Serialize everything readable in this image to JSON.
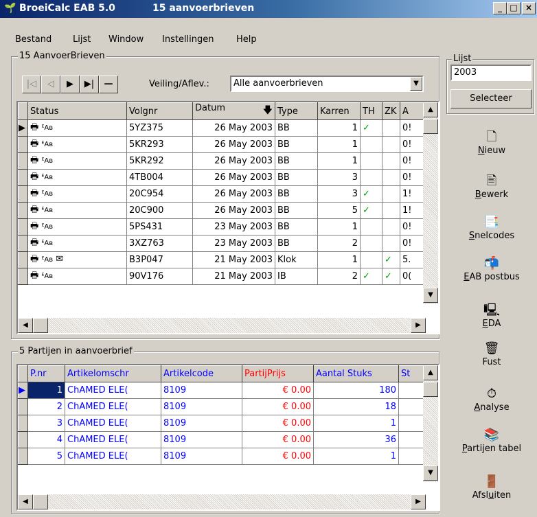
{
  "window": {
    "app": "BroeiCalc EAB 5.0",
    "doc": "15 aanvoerbrieven",
    "min": "_",
    "max": "□",
    "close": "×"
  },
  "menu": [
    "Bestand",
    "Lijst",
    "Window",
    "Instellingen",
    "Help"
  ],
  "top_group": {
    "label": "15 AanvoerBrieven",
    "nav": [
      "|◁",
      "◁",
      "▶",
      "▶|",
      "—"
    ],
    "filter_label": "Veiling/Aflev.:",
    "filter_value": "Alle aanvoerbrieven"
  },
  "top_grid": {
    "columns": [
      "Status",
      "Volgnr",
      "Datum",
      "Type",
      "Karren",
      "TH",
      "ZK",
      "A"
    ],
    "rows": [
      {
        "volgnr": "5YZ375",
        "datum": "26 May 2003",
        "type": "BB",
        "karren": "1",
        "th": "✓",
        "zk": "",
        "a": "0!"
      },
      {
        "volgnr": "5KR293",
        "datum": "26 May 2003",
        "type": "BB",
        "karren": "1",
        "th": "",
        "zk": "",
        "a": "0!"
      },
      {
        "volgnr": "5KR292",
        "datum": "26 May 2003",
        "type": "BB",
        "karren": "1",
        "th": "",
        "zk": "",
        "a": "0!"
      },
      {
        "volgnr": "4TB004",
        "datum": "26 May 2003",
        "type": "BB",
        "karren": "3",
        "th": "",
        "zk": "",
        "a": "0!"
      },
      {
        "volgnr": "20C954",
        "datum": "26 May 2003",
        "type": "BB",
        "karren": "3",
        "th": "✓",
        "zk": "",
        "a": "1!"
      },
      {
        "volgnr": "20C900",
        "datum": "26 May 2003",
        "type": "BB",
        "karren": "5",
        "th": "✓",
        "zk": "",
        "a": "1!"
      },
      {
        "volgnr": "5PS431",
        "datum": "23 May 2003",
        "type": "BB",
        "karren": "1",
        "th": "",
        "zk": "",
        "a": "0!"
      },
      {
        "volgnr": "3XZ763",
        "datum": "23 May 2003",
        "type": "BB",
        "karren": "2",
        "th": "",
        "zk": "",
        "a": "0!"
      },
      {
        "volgnr": "B3P047",
        "datum": "21 May 2003",
        "type": "Klok",
        "karren": "1",
        "th": "",
        "zk": "✓",
        "a": "5."
      },
      {
        "volgnr": "90V176",
        "datum": "21 May 2003",
        "type": "IB",
        "karren": "2",
        "th": "✓",
        "zk": "✓",
        "a": "0("
      }
    ]
  },
  "bottom_group": {
    "label": "5 Partijen in aanvoerbrief"
  },
  "bottom_grid": {
    "columns": [
      "P.nr",
      "Artikelomschr",
      "Artikelcode",
      "PartijPrijs",
      "Aantal Stuks",
      "St"
    ],
    "rows": [
      {
        "pnr": "1",
        "omschr": "ChAMED ELE(",
        "code": "8109",
        "prijs": "€ 0.00",
        "aantal": "180"
      },
      {
        "pnr": "2",
        "omschr": "ChAMED ELE(",
        "code": "8109",
        "prijs": "€ 0.00",
        "aantal": "18"
      },
      {
        "pnr": "3",
        "omschr": "ChAMED ELE(",
        "code": "8109",
        "prijs": "€ 0.00",
        "aantal": "1"
      },
      {
        "pnr": "4",
        "omschr": "ChAMED ELE(",
        "code": "8109",
        "prijs": "€ 0.00",
        "aantal": "36"
      },
      {
        "pnr": "5",
        "omschr": "ChAMED ELE(",
        "code": "8109",
        "prijs": "€ 0.00",
        "aantal": "1"
      }
    ]
  },
  "lijst": {
    "label": "Lijst",
    "value": "2003",
    "button": "Selecteer"
  },
  "toolbar": [
    {
      "pre": "",
      "u": "N",
      "post": "ieuw",
      "icon": "new-document-icon"
    },
    {
      "pre": "",
      "u": "B",
      "post": "ewerk",
      "icon": "edit-document-icon"
    },
    {
      "pre": "",
      "u": "S",
      "post": "nelcodes",
      "icon": "quick-codes-icon"
    },
    {
      "pre": "",
      "u": "E",
      "post": "AB postbus",
      "icon": "mailbox-icon"
    },
    {
      "pre": "",
      "u": "E",
      "post": "DA",
      "icon": "eda-icon"
    },
    {
      "pre": "Fust",
      "u": "",
      "post": "",
      "icon": "bucket-icon"
    },
    {
      "pre": "",
      "u": "A",
      "post": "nalyse",
      "icon": "analysis-icon"
    },
    {
      "pre": "",
      "u": "P",
      "post": "artijen tabel",
      "icon": "batch-table-icon"
    },
    {
      "pre": "Afsl",
      "u": "u",
      "post": "iten",
      "icon": "exit-icon"
    }
  ]
}
